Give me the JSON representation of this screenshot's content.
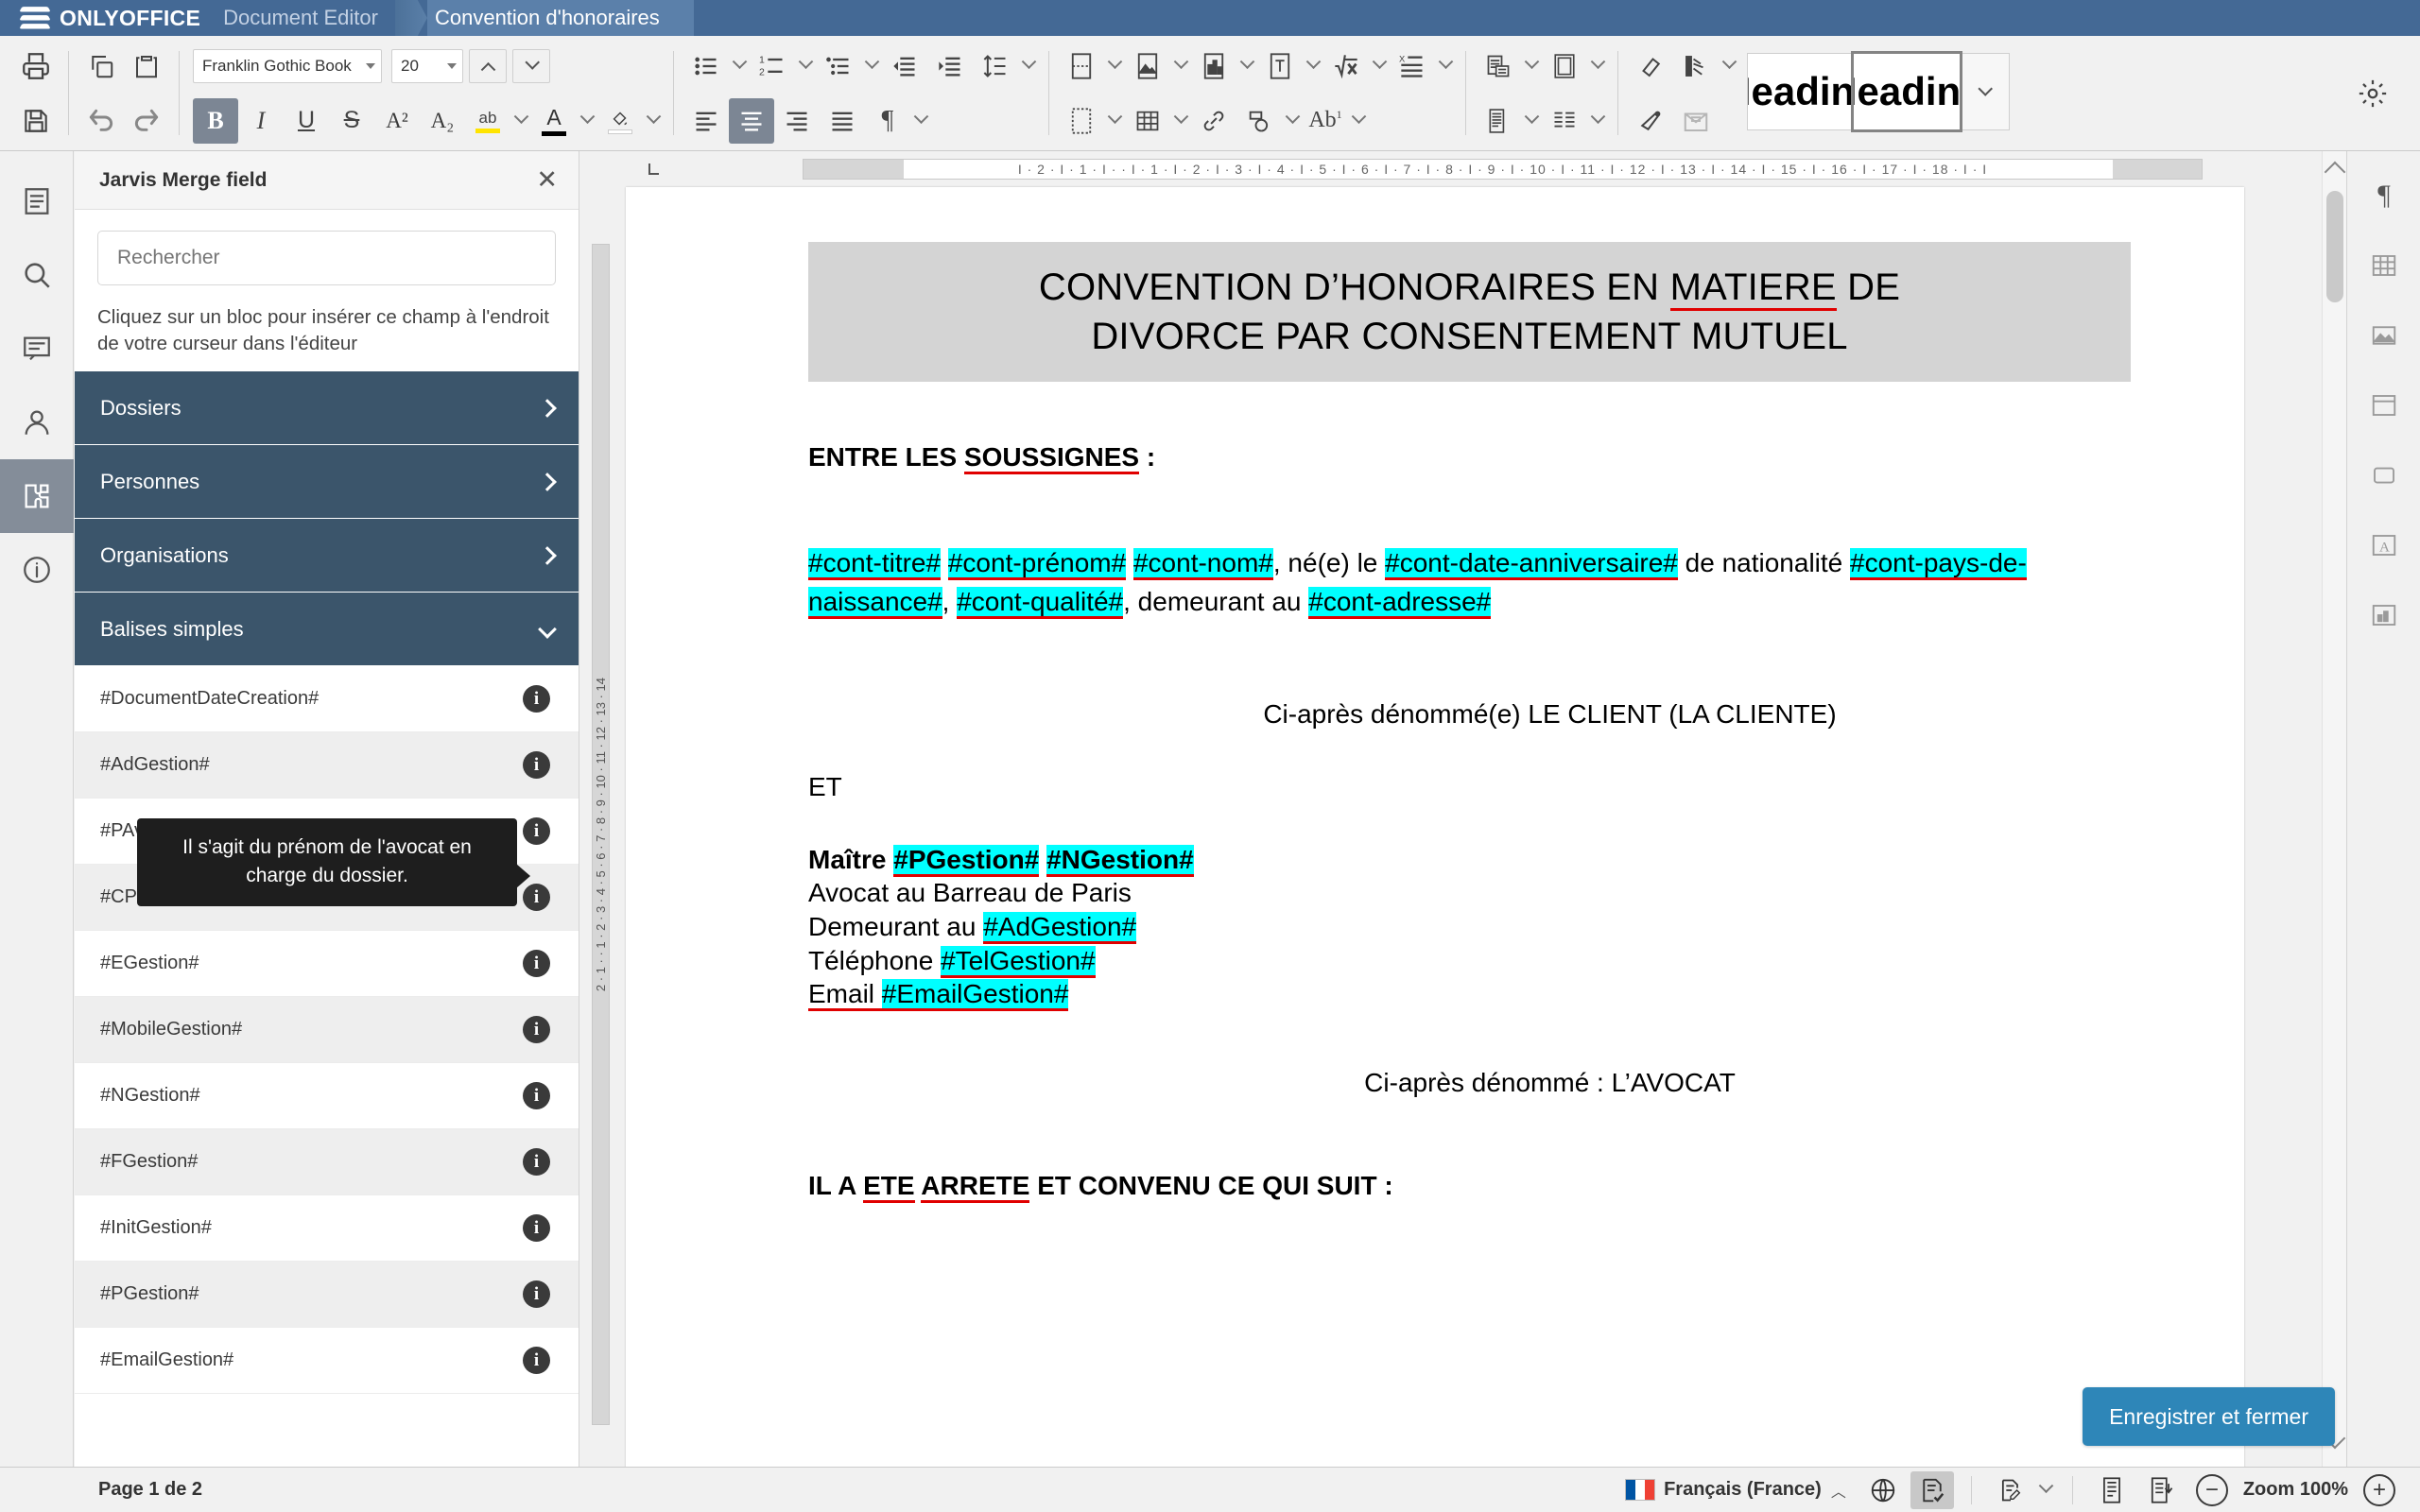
{
  "titlebar": {
    "brand": "ONLYOFFICE",
    "app_name": "Document Editor",
    "document_tab": "Convention d'honoraires",
    "brand_bg": "#446995"
  },
  "toolbar": {
    "font_name": "Franklin Gothic Book",
    "font_size": "20",
    "bold_label": "B",
    "italic_label": "I",
    "underline_label": "U",
    "strike_label": "S",
    "superscript_label": "A²",
    "subscript_label": "A₂",
    "highlight_label": "ab",
    "fontcolor_label": "A",
    "style_gallery": [
      {
        "label": "Heading",
        "selected": false
      },
      {
        "label": "Heading",
        "selected": true
      }
    ]
  },
  "panel": {
    "title": "Jarvis Merge field",
    "close_label": "✕",
    "search": {
      "placeholder": "Rechercher",
      "value": ""
    },
    "hint": "Cliquez sur un bloc pour insérer ce champ à l'endroit de votre curseur dans l'éditeur",
    "groups": [
      {
        "label": "Dossiers",
        "expanded": false
      },
      {
        "label": "Personnes",
        "expanded": false
      },
      {
        "label": "Organisations",
        "expanded": false
      },
      {
        "label": "Balises simples",
        "expanded": true
      }
    ],
    "fields": [
      "#DocumentDateCreation#",
      "#AdGestion#",
      "#PAvocat#",
      "#CPGestion#",
      "#EGestion#",
      "#MobileGestion#",
      "#NGestion#",
      "#FGestion#",
      "#InitGestion#",
      "#PGestion#",
      "#EmailGestion#"
    ],
    "tooltip": "Il s'agit du prénom de l'avocat en charge du dossier."
  },
  "ruler": {
    "horizontal": "I  · 2 · I · 1 · I · · I · 1 · I · 2 · I · 3 · I · 4 · I · 5 · I · 6 · I · 7 · I · 8 · I · 9 · I · 10 · I · 11 · I · 12 · I · 13 · I · 14 · I · 15 · I · 16 · I · 17 · I · 18 · I · I",
    "corner_label": "L",
    "vertical": "2 · 1 · · 1 · 2 · 3 · 4 · 5 · 6 · 7 · 8 · 9 · 10 · 11 · 12 · 13 · 14"
  },
  "document": {
    "title_line1_a": "CONVENTION D’HONORAIRES EN ",
    "title_line1_b": "MATIERE",
    "title_line1_c": " DE",
    "title_line2": "DIVORCE PAR CONSENTEMENT MUTUEL",
    "intro_a": "ENTRE LES ",
    "intro_b": "SOUSSIGNES",
    "intro_c": " :",
    "client_line1": [
      {
        "text": "#cont-titre#",
        "hl": true
      },
      {
        "text": " ",
        "hl": false
      },
      {
        "text": "#cont-prénom#",
        "hl": true
      },
      {
        "text": " ",
        "hl": false
      },
      {
        "text": "#cont-nom#",
        "hl": true
      },
      {
        "text": ", né(e) le ",
        "hl": false
      },
      {
        "text": "#cont-date-anniversaire#",
        "hl": true
      },
      {
        "text": " de nationalité ",
        "hl": false
      },
      {
        "text": "#cont-pays-de-naissance#",
        "hl": true
      },
      {
        "text": ", ",
        "hl": false
      },
      {
        "text": "#cont-qualité#",
        "hl": true
      },
      {
        "text": ", demeurant au ",
        "hl": false
      },
      {
        "text": "#cont-adresse#",
        "hl": true
      }
    ],
    "client_denom": "Ci-après dénommé(e) LE CLIENT (LA CLIENTE)",
    "et": "ET",
    "lawyer_lines": [
      [
        {
          "text": "Maître ",
          "hl": false
        },
        {
          "text": "#PGestion#",
          "hl": true
        },
        {
          "text": " ",
          "hl": false
        },
        {
          "text": "#NGestion#",
          "hl": true
        }
      ],
      [
        {
          "text": "Avocat au Barreau de Paris",
          "hl": false
        }
      ],
      [
        {
          "text": "Demeurant au ",
          "hl": false
        },
        {
          "text": "#AdGestion#",
          "hl": true
        }
      ],
      [
        {
          "text": "Téléphone ",
          "hl": false
        },
        {
          "text": "#TelGestion#",
          "hl": true
        }
      ],
      [
        {
          "text": "Email ",
          "hl": false,
          "spell": true
        },
        {
          "text": "#EmailGestion#",
          "hl": true
        }
      ]
    ],
    "lawyer_denom": "Ci-après dénommé : L’AVOCAT",
    "agreement_a": "IL A ",
    "agreement_b": "ETE",
    "agreement_c": " ",
    "agreement_d": "ARRETE",
    "agreement_e": " ET CONVENU CE QUI SUIT :",
    "highlight_color": "#00ffff",
    "title_bg": "#d4d4d4",
    "spell_color": "#e00000"
  },
  "footer_button": {
    "label": "Enregistrer et fermer",
    "color": "#2e86b8"
  },
  "status": {
    "page_label": "Page 1 de 2",
    "language": "Français (France)",
    "zoom_label": "Zoom 100%",
    "zoom_out": "−",
    "zoom_in": "+"
  }
}
